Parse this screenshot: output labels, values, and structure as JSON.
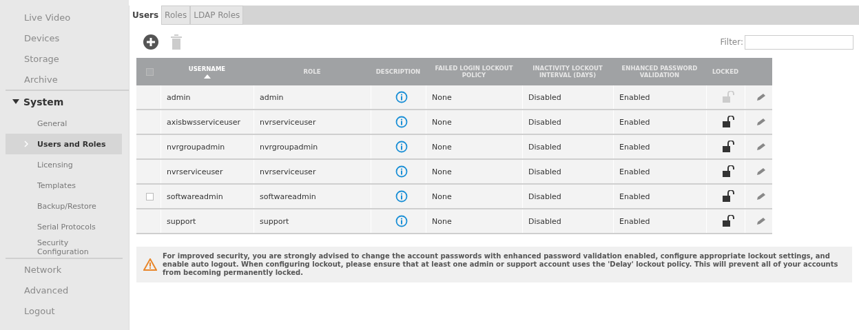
{
  "sidebar": {
    "items": [
      {
        "label": "Live Video",
        "selected": false
      },
      {
        "label": "Devices",
        "selected": false
      },
      {
        "label": "Storage",
        "selected": false
      },
      {
        "label": "Archive",
        "selected": false
      },
      {
        "label": "System",
        "expanded": true,
        "children": [
          {
            "label": "General",
            "selected": false
          },
          {
            "label": "Users and Roles",
            "selected": true
          },
          {
            "label": "Licensing",
            "selected": false
          },
          {
            "label": "Templates",
            "selected": false
          },
          {
            "label": "Backup/Restore",
            "selected": false
          },
          {
            "label": "Serial Protocols",
            "selected": false
          },
          {
            "label": "Security Configuration",
            "selected": false
          }
        ]
      },
      {
        "label": "Network",
        "selected": false
      },
      {
        "label": "Advanced",
        "selected": false
      },
      {
        "label": "Logout",
        "selected": false
      }
    ]
  },
  "tabs": [
    {
      "label": "Users",
      "selected": true
    },
    {
      "label": "Roles",
      "selected": false
    },
    {
      "label": "LDAP Roles",
      "selected": false
    }
  ],
  "toolbar": {
    "delete_disabled": true
  },
  "filter": {
    "label": "Filter:"
  },
  "table": {
    "select_all": {
      "checked": false
    },
    "columns": [
      {
        "label": "USERNAME",
        "sorted": true
      },
      {
        "label": "ROLE",
        "sorted": false
      },
      {
        "label": "DESCRIPTION",
        "sorted": false
      },
      {
        "label": "FAILED LOGIN LOCKOUT POLICY",
        "sorted": false
      },
      {
        "label": "INACTIVITY LOCKOUT INTERVAL (DAYS)",
        "sorted": false
      },
      {
        "label": "ENHANCED PASSWORD VALIDATION",
        "sorted": false
      },
      {
        "label": "LOCKED",
        "sorted": false
      }
    ],
    "rows": [
      {
        "username": "admin",
        "role": "admin",
        "lockout_policy": "None",
        "inactivity": "Disabled",
        "password_validation": "Enabled",
        "kind": "protected",
        "checked": false,
        "lock_disabled": true
      },
      {
        "username": "axisbwsserviceuser",
        "role": "nvrserviceuser",
        "lockout_policy": "None",
        "inactivity": "Disabled",
        "password_validation": "Enabled",
        "kind": "protected",
        "checked": false,
        "lock_disabled": false
      },
      {
        "username": "nvrgroupadmin",
        "role": "nvrgroupadmin",
        "lockout_policy": "None",
        "inactivity": "Disabled",
        "password_validation": "Enabled",
        "kind": "protected",
        "checked": false,
        "lock_disabled": false
      },
      {
        "username": "nvrserviceuser",
        "role": "nvrserviceuser",
        "lockout_policy": "None",
        "inactivity": "Disabled",
        "password_validation": "Enabled",
        "kind": "protected",
        "checked": false,
        "lock_disabled": false
      },
      {
        "username": "softwareadmin",
        "role": "softwareadmin",
        "lockout_policy": "None",
        "inactivity": "Disabled",
        "password_validation": "Enabled",
        "kind": "deletable",
        "checked": false,
        "lock_disabled": false
      },
      {
        "username": "support",
        "role": "support",
        "lockout_policy": "None",
        "inactivity": "Disabled",
        "password_validation": "Enabled",
        "kind": "protected",
        "checked": false,
        "lock_disabled": false
      }
    ]
  },
  "warning": {
    "text": "For improved security, you are strongly advised to change the account passwords with enhanced password validation enabled, configure appropriate lockout settings, and enable auto logout. When configuring lockout, please ensure that at least one admin or support account uses the 'Delay' lockout policy. This will prevent all of your accounts from becoming permanently locked."
  }
}
